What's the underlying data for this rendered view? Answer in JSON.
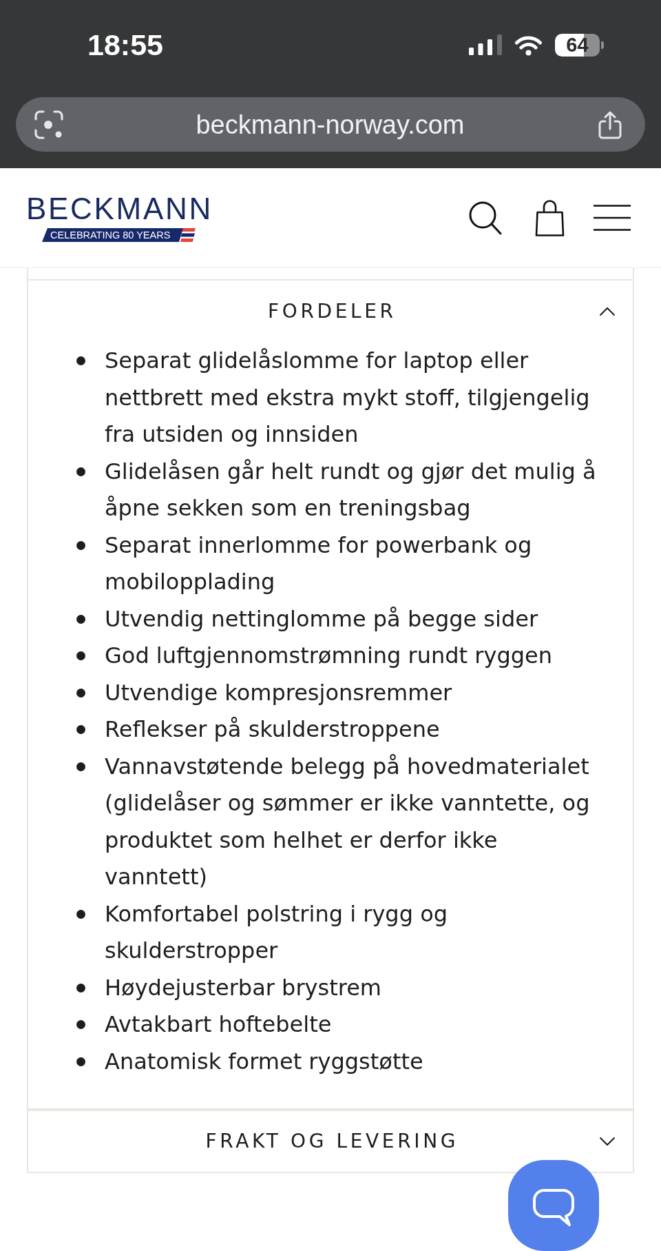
{
  "status_bar": {
    "time": "18:55",
    "battery": "64"
  },
  "address_bar": {
    "url": "beckmann-norway.com"
  },
  "header": {
    "logo": {
      "wordmark": "BECKMANN",
      "tagline": "CELEBRATING 80 YEARS"
    }
  },
  "sections": [
    {
      "title": "FORDELER",
      "expanded": true,
      "items": [
        "Separat glidelåslomme for laptop eller nettbrett med ekstra mykt stoff, tilgjengelig fra utsiden og innsiden",
        "Glidelåsen går helt rundt og gjør det mulig å åpne sekken som en treningsbag",
        "Separat innerlomme for powerbank og mobilopplading",
        "Utvendig nettinglomme på begge sider",
        "God luftgjennomstrømning rundt ryggen",
        "Utvendige kompresjonsremmer",
        "Reflekser på skulderstroppene",
        "Vannavstøtende belegg på hovedmaterialet (glidelåser og sømmer er ikke vanntette, og produktet som helhet er derfor ikke vanntett)",
        "Komfortabel polstring i rygg og skulderstropper",
        "Høydejusterbar brystrem",
        "Avtakbart hoftebelte",
        "Anatomisk formet ryggstøtte"
      ]
    },
    {
      "title": "FRAKT OG LEVERING",
      "expanded": false
    }
  ]
}
